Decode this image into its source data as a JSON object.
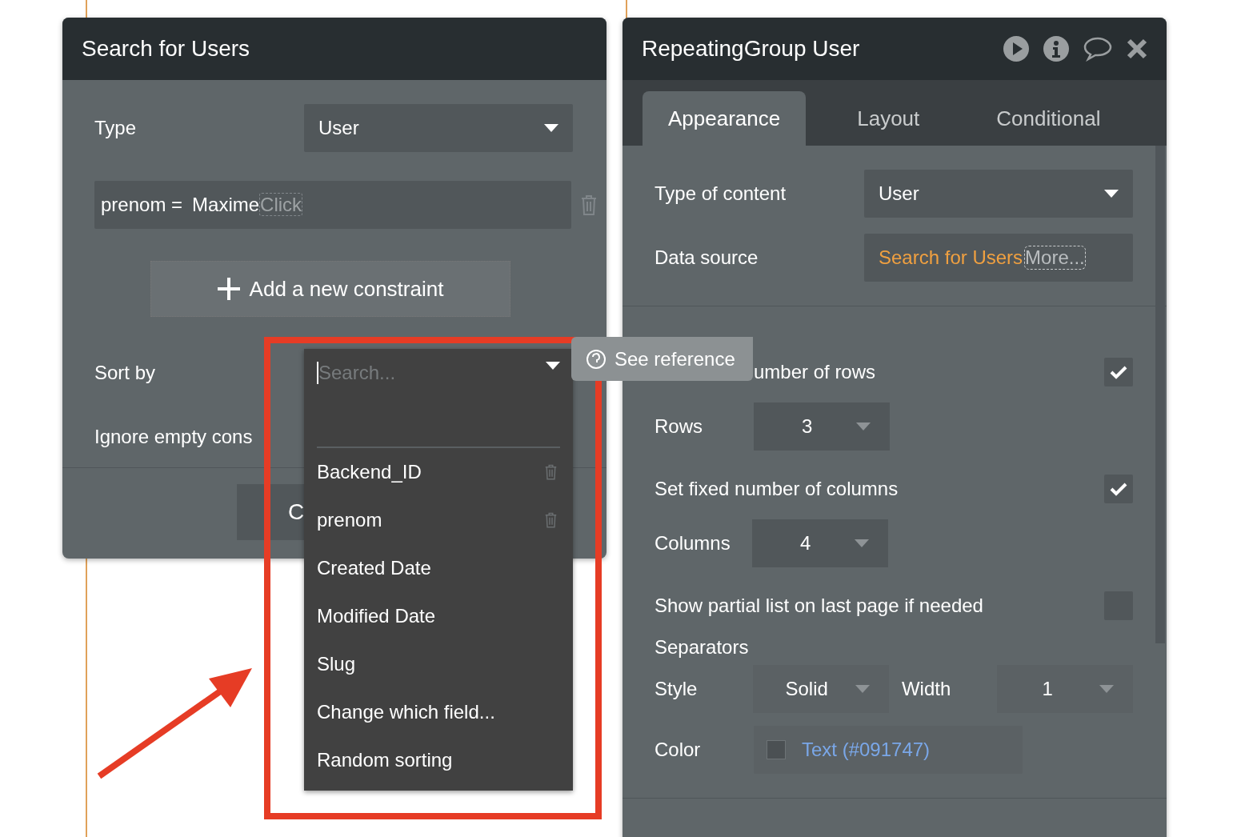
{
  "left_panel": {
    "title": "Search for Users",
    "type": {
      "label": "Type",
      "value": "User"
    },
    "constraint": {
      "field": "prenom =",
      "value": "Maxime",
      "placeholder": "Click"
    },
    "add_button": "Add a new constraint",
    "sort_label": "Sort by",
    "ignore_label": "Ignore empty cons",
    "footer_button": "C"
  },
  "sort_dropdown": {
    "placeholder": "Search...",
    "options": [
      {
        "label": "Backend_ID",
        "deletable": true
      },
      {
        "label": "prenom",
        "deletable": true
      },
      {
        "label": "Created Date",
        "deletable": false
      },
      {
        "label": "Modified Date",
        "deletable": false
      },
      {
        "label": "Slug",
        "deletable": false
      },
      {
        "label": "Change which field...",
        "deletable": false
      },
      {
        "label": "Random sorting",
        "deletable": false
      }
    ]
  },
  "tooltip": {
    "label": "See reference"
  },
  "right_panel": {
    "title": "RepeatingGroup User",
    "tabs": [
      {
        "label": "Appearance",
        "selected": true
      },
      {
        "label": "Layout",
        "selected": false
      },
      {
        "label": "Conditional",
        "selected": false
      }
    ],
    "type_of_content": {
      "label": "Type of content",
      "value": "User"
    },
    "data_source": {
      "label": "Data source",
      "value": "Search for Users",
      "more": "More..."
    },
    "rows_toggle": {
      "label": "umber of rows",
      "checked": true
    },
    "rows": {
      "label": "Rows",
      "value": "3"
    },
    "columns_toggle": {
      "label": "Set fixed number of columns",
      "checked": true
    },
    "columns": {
      "label": "Columns",
      "value": "4"
    },
    "partial_toggle": {
      "label": "Show partial list on last page if needed",
      "checked": false
    },
    "separators_label": "Separators",
    "style": {
      "label": "Style",
      "value": "Solid"
    },
    "width": {
      "label": "Width",
      "value": "1"
    },
    "color": {
      "label": "Color",
      "value": "Text (#091747)"
    }
  }
}
